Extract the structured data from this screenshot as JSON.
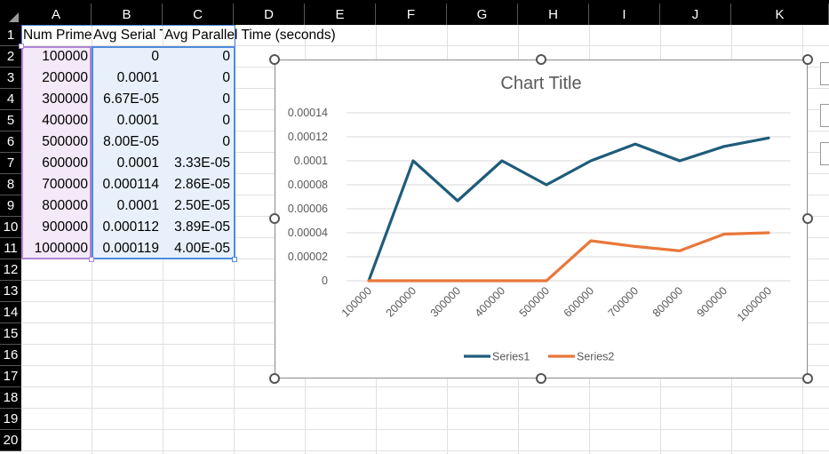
{
  "columns": [
    "A",
    "B",
    "C",
    "D",
    "E",
    "F",
    "G",
    "H",
    "I",
    "J",
    "K"
  ],
  "rows": [
    "1",
    "2",
    "3",
    "4",
    "5",
    "6",
    "7",
    "8",
    "9",
    "10",
    "11",
    "12",
    "13",
    "14",
    "15",
    "16",
    "17",
    "18",
    "19",
    "20"
  ],
  "header_cells": {
    "a1": "Num Primes",
    "b1": "Avg Serial Time (seconds)",
    "c1": "Avg Parallel Time (seconds)"
  },
  "table": [
    [
      "100000",
      "0",
      "0"
    ],
    [
      "200000",
      "0.0001",
      "0"
    ],
    [
      "300000",
      "6.67E-05",
      "0"
    ],
    [
      "400000",
      "0.0001",
      "0"
    ],
    [
      "500000",
      "8.00E-05",
      "0"
    ],
    [
      "600000",
      "0.0001",
      "3.33E-05"
    ],
    [
      "700000",
      "0.000114",
      "2.86E-05"
    ],
    [
      "800000",
      "0.0001",
      "2.50E-05"
    ],
    [
      "900000",
      "0.000112",
      "3.89E-05"
    ],
    [
      "1000000",
      "0.000119",
      "4.00E-05"
    ]
  ],
  "colors": {
    "series1": "#1f5c7a",
    "series2": "#e8773a",
    "grid": "#d9d9d9",
    "selection_primary": "#4f8be0",
    "selection_secondary": "#b086d4"
  },
  "chart_data": {
    "type": "line",
    "title": "Chart Title",
    "categories": [
      "100000",
      "200000",
      "300000",
      "400000",
      "500000",
      "600000",
      "700000",
      "800000",
      "900000",
      "1000000"
    ],
    "series": [
      {
        "name": "Series1",
        "values": [
          0,
          0.0001,
          6.67e-05,
          0.0001,
          8e-05,
          0.0001,
          0.000114,
          0.0001,
          0.000112,
          0.000119
        ]
      },
      {
        "name": "Series2",
        "values": [
          0,
          0,
          0,
          0,
          0,
          3.33e-05,
          2.86e-05,
          2.5e-05,
          3.89e-05,
          4e-05
        ]
      }
    ],
    "yticks": [
      "0",
      "0.00002",
      "0.00004",
      "0.00006",
      "0.00008",
      "0.0001",
      "0.00012",
      "0.00014"
    ],
    "ylim": [
      0,
      0.00014
    ],
    "grid": true,
    "legend": "bottom"
  }
}
